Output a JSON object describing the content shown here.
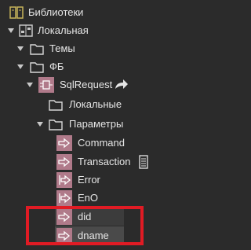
{
  "tree": {
    "library": {
      "label": "Библиотеки",
      "icon": "library-icon"
    },
    "local": {
      "label": "Локальная",
      "icon": "local-library-icon"
    },
    "topics": {
      "label": "Темы",
      "icon": "folder-icon"
    },
    "fb": {
      "label": "ФБ",
      "icon": "folder-icon"
    },
    "sqlrequest": {
      "label": "SqlRequest",
      "icon": "function-block-icon",
      "action_icon": "share-arrow-icon"
    },
    "locals": {
      "label": "Локальные",
      "icon": "folder-icon"
    },
    "params": {
      "label": "Параметры",
      "icon": "folder-icon"
    },
    "param_items": [
      {
        "label": "Command",
        "icon": "input-param-icon"
      },
      {
        "label": "Transaction",
        "icon": "input-param-icon",
        "extra_icon": "list-icon"
      },
      {
        "label": "Error",
        "icon": "output-param-icon"
      },
      {
        "label": "EnO",
        "icon": "output-param-icon"
      },
      {
        "label": "did",
        "icon": "input-param-icon"
      },
      {
        "label": "dname",
        "icon": "input-param-icon"
      }
    ]
  },
  "colors": {
    "background": "#2b2b2b",
    "highlight_box": "#e01b24",
    "param_icon_bg": "#b07a8a",
    "text": "#e6e6e6"
  }
}
